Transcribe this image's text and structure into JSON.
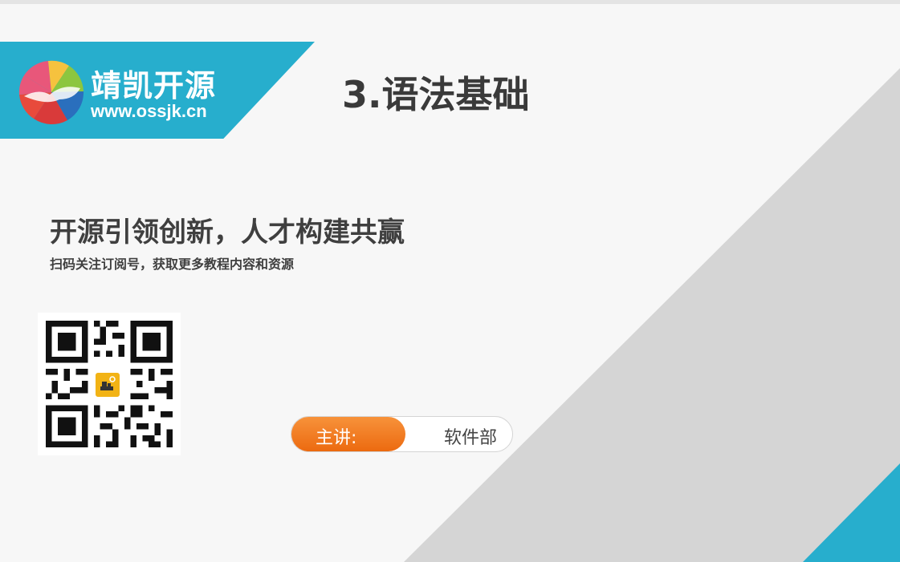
{
  "brand": {
    "name": "靖凯开源",
    "url": "www.ossjk.cn"
  },
  "slide": {
    "title": "3.语法基础",
    "slogan": "开源引领创新，人才构建共赢",
    "subtext": "扫码关注订阅号，获取更多教程内容和资源"
  },
  "presenter": {
    "label": "主讲:",
    "name": "软件部"
  },
  "icons": {
    "logo": "brand-logo-icon",
    "qr": "qr-code-icon",
    "qr_center": "qr-center-logo-icon"
  },
  "colors": {
    "banner": "#27aecd",
    "pill": "#ef7a1f",
    "diagonal": "#d5d5d5",
    "corner": "#27aecd"
  }
}
